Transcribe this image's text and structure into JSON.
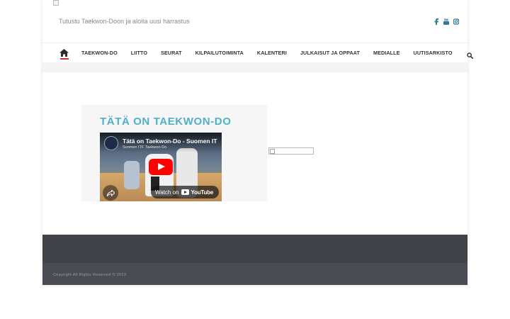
{
  "header": {
    "tagline": "Tutustu Taekwon-Doon ja aloita uusi harrastus",
    "social": [
      {
        "icon": "facebook-icon"
      },
      {
        "icon": "youtube-icon"
      },
      {
        "icon": "instagram-icon"
      }
    ]
  },
  "nav": {
    "home_icon": "home-icon",
    "items": [
      {
        "label": "TAEKWON-DO"
      },
      {
        "label": "LIITTO"
      },
      {
        "label": "SEURAT"
      },
      {
        "label": "KILPAILUTOIMINTA"
      },
      {
        "label": "KALENTERI"
      },
      {
        "label": "JULKAISUT JA OPPAAT"
      },
      {
        "label": "MEDIALLE"
      },
      {
        "label": "UUTISARKISTO"
      }
    ],
    "search_icon": "search-icon"
  },
  "widget": {
    "title": "TÄTÄ ON TAEKWON-DO",
    "video": {
      "title": "Tätä on Taekwon-Do - Suomen IT",
      "channel": "Suomen ITF Taekwon-Do",
      "watch_label": "Watch on",
      "watch_brand": "YouTube"
    }
  },
  "footer": {
    "copyright": "Copyright All Rights Reserved © 2023"
  },
  "colors": {
    "accent": "#4fb0c6",
    "home_underline": "#c0392b",
    "footer_dark": "#414349",
    "footer_bottom": "#4a4c53",
    "social_icon": "#2f7c96"
  }
}
